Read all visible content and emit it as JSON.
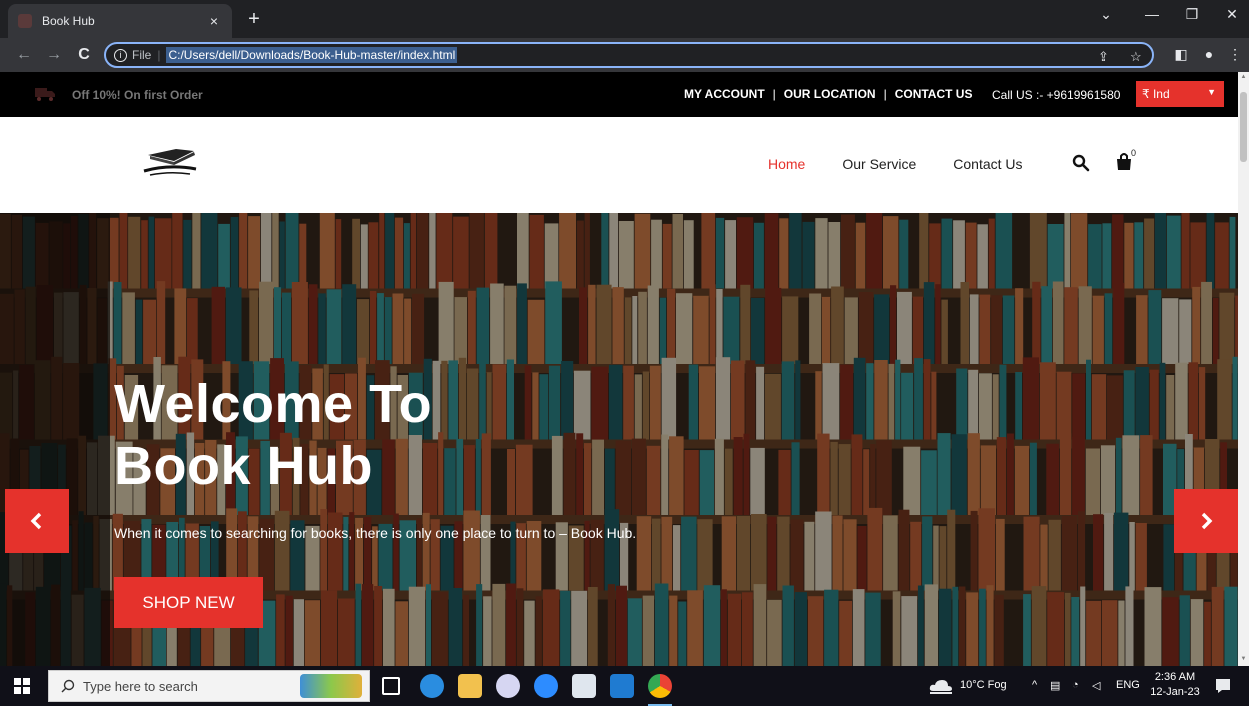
{
  "browser": {
    "tab_title": "Book Hub",
    "tab_close": "×",
    "new_tab": "+",
    "url_scheme_label": "File",
    "url": "C:/Users/dell/Downloads/Book-Hub-master/index.html"
  },
  "topbar": {
    "offer": "Off 10%! On first Order",
    "links": [
      "MY ACCOUNT",
      "OUR LOCATION",
      "CONTACT US"
    ],
    "separator": "|",
    "call": "Call US :- +9619961580",
    "currency": "₹ Ind"
  },
  "nav": {
    "items": [
      "Home",
      "Our Service",
      "Contact Us"
    ],
    "active_index": 0,
    "cart_count": "0"
  },
  "hero": {
    "title_line1": "Welcome To",
    "title_line2": "Book Hub",
    "subtitle": "When it comes to searching for books, there is only one place to turn to – Book Hub.",
    "cta": "SHOP NEW"
  },
  "taskbar": {
    "search_placeholder": "Type here to search",
    "weather": "10°C  Fog",
    "language": "ENG",
    "time": "2:36 AM",
    "date": "12-Jan-23"
  },
  "colors": {
    "accent": "#e5322c",
    "topbar_bg": "#000000",
    "browser_chrome": "#35363a"
  }
}
